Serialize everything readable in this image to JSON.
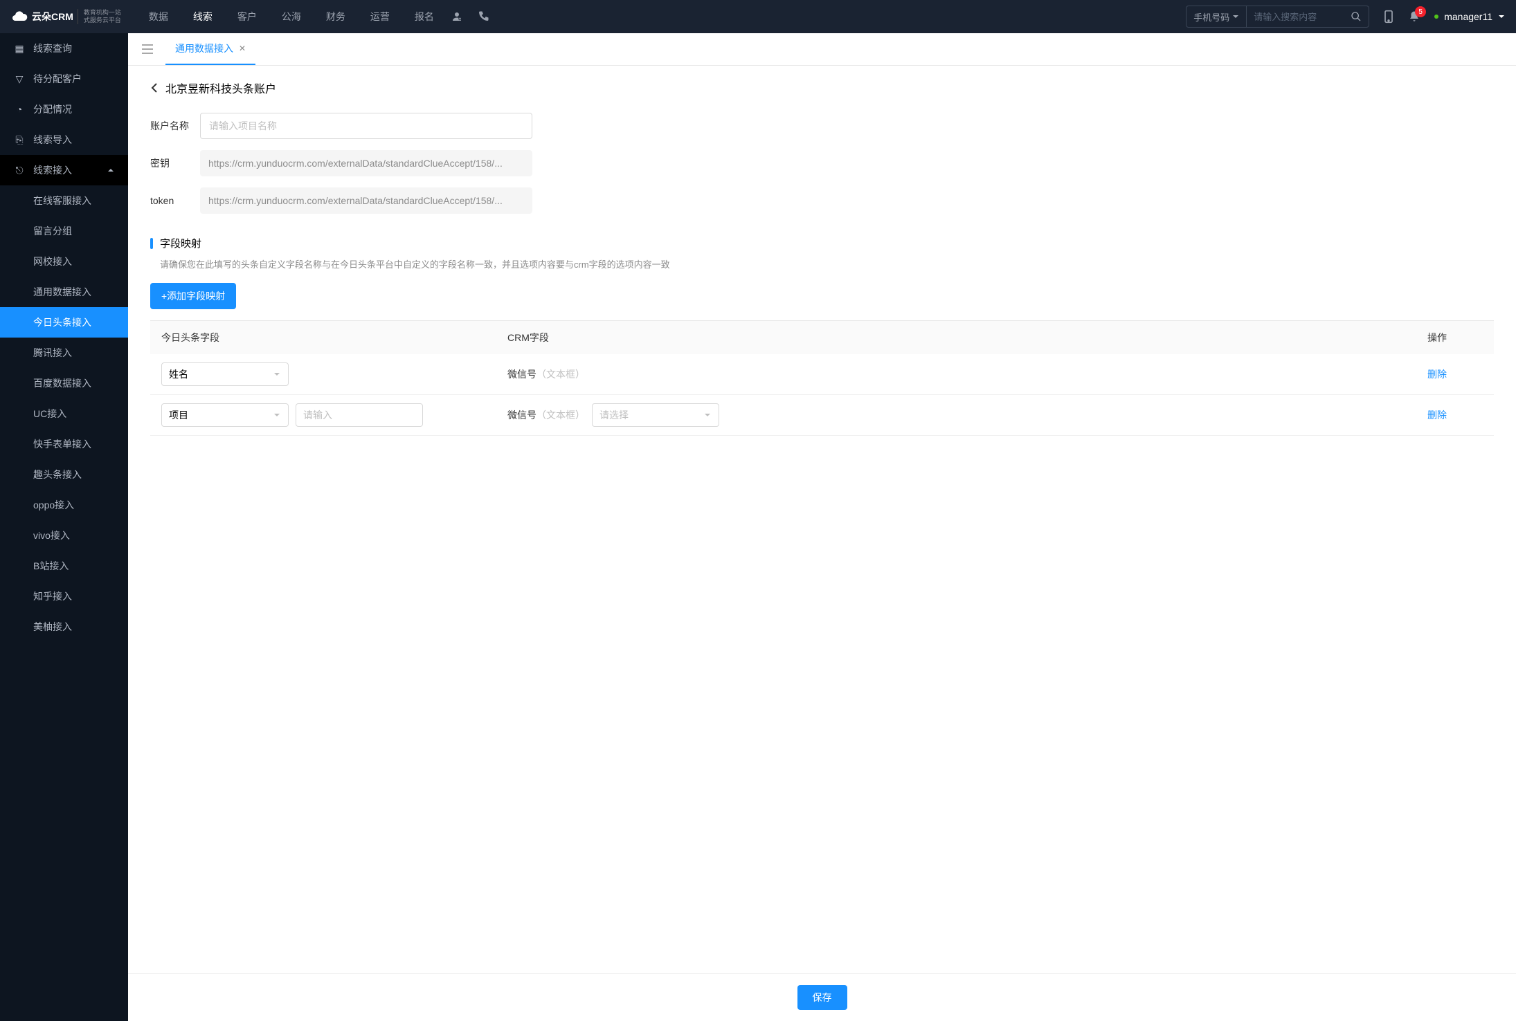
{
  "header": {
    "logo_text": "云朵CRM",
    "logo_sub1": "教育机构一站",
    "logo_sub2": "式服务云平台",
    "nav": [
      "数据",
      "线索",
      "客户",
      "公海",
      "财务",
      "运营",
      "报名"
    ],
    "nav_active": 1,
    "search_type": "手机号码",
    "search_placeholder": "请输入搜索内容",
    "badge": "5",
    "user": "manager11"
  },
  "sidebar": {
    "items": [
      {
        "label": "线索查询"
      },
      {
        "label": "待分配客户"
      },
      {
        "label": "分配情况"
      },
      {
        "label": "线索导入"
      },
      {
        "label": "线索接入",
        "expanded": true,
        "children": [
          {
            "label": "在线客服接入"
          },
          {
            "label": "留言分组"
          },
          {
            "label": "网校接入"
          },
          {
            "label": "通用数据接入"
          },
          {
            "label": "今日头条接入",
            "active": true
          },
          {
            "label": "腾讯接入"
          },
          {
            "label": "百度数据接入"
          },
          {
            "label": "UC接入"
          },
          {
            "label": "快手表单接入"
          },
          {
            "label": "趣头条接入"
          },
          {
            "label": "oppo接入"
          },
          {
            "label": "vivo接入"
          },
          {
            "label": "B站接入"
          },
          {
            "label": "知乎接入"
          },
          {
            "label": "美柚接入"
          }
        ]
      }
    ]
  },
  "tab": {
    "label": "通用数据接入"
  },
  "page": {
    "title": "北京昱新科技头条账户",
    "account_label": "账户名称",
    "account_placeholder": "请输入项目名称",
    "secret_label": "密钥",
    "secret_value": "https://crm.yunduocrm.com/externalData/standardClueAccept/158/...",
    "token_label": "token",
    "token_value": "https://crm.yunduocrm.com/externalData/standardClueAccept/158/...",
    "section_title": "字段映射",
    "section_hint": "请确保您在此填写的头条自定义字段名称与在今日头条平台中自定义的字段名称一致，并且选项内容要与crm字段的选项内容一致",
    "add_btn": "+添加字段映射",
    "cols": [
      "今日头条字段",
      "CRM字段",
      "操作"
    ],
    "rows": [
      {
        "tt_field": "姓名",
        "crm_field": "微信号",
        "crm_hint": "（文本框）",
        "delete": "删除"
      },
      {
        "tt_field": "项目",
        "extra_placeholder": "请输入",
        "crm_field": "微信号",
        "crm_hint": "（文本框）",
        "select_placeholder": "请选择",
        "delete": "删除"
      }
    ],
    "save": "保存"
  }
}
